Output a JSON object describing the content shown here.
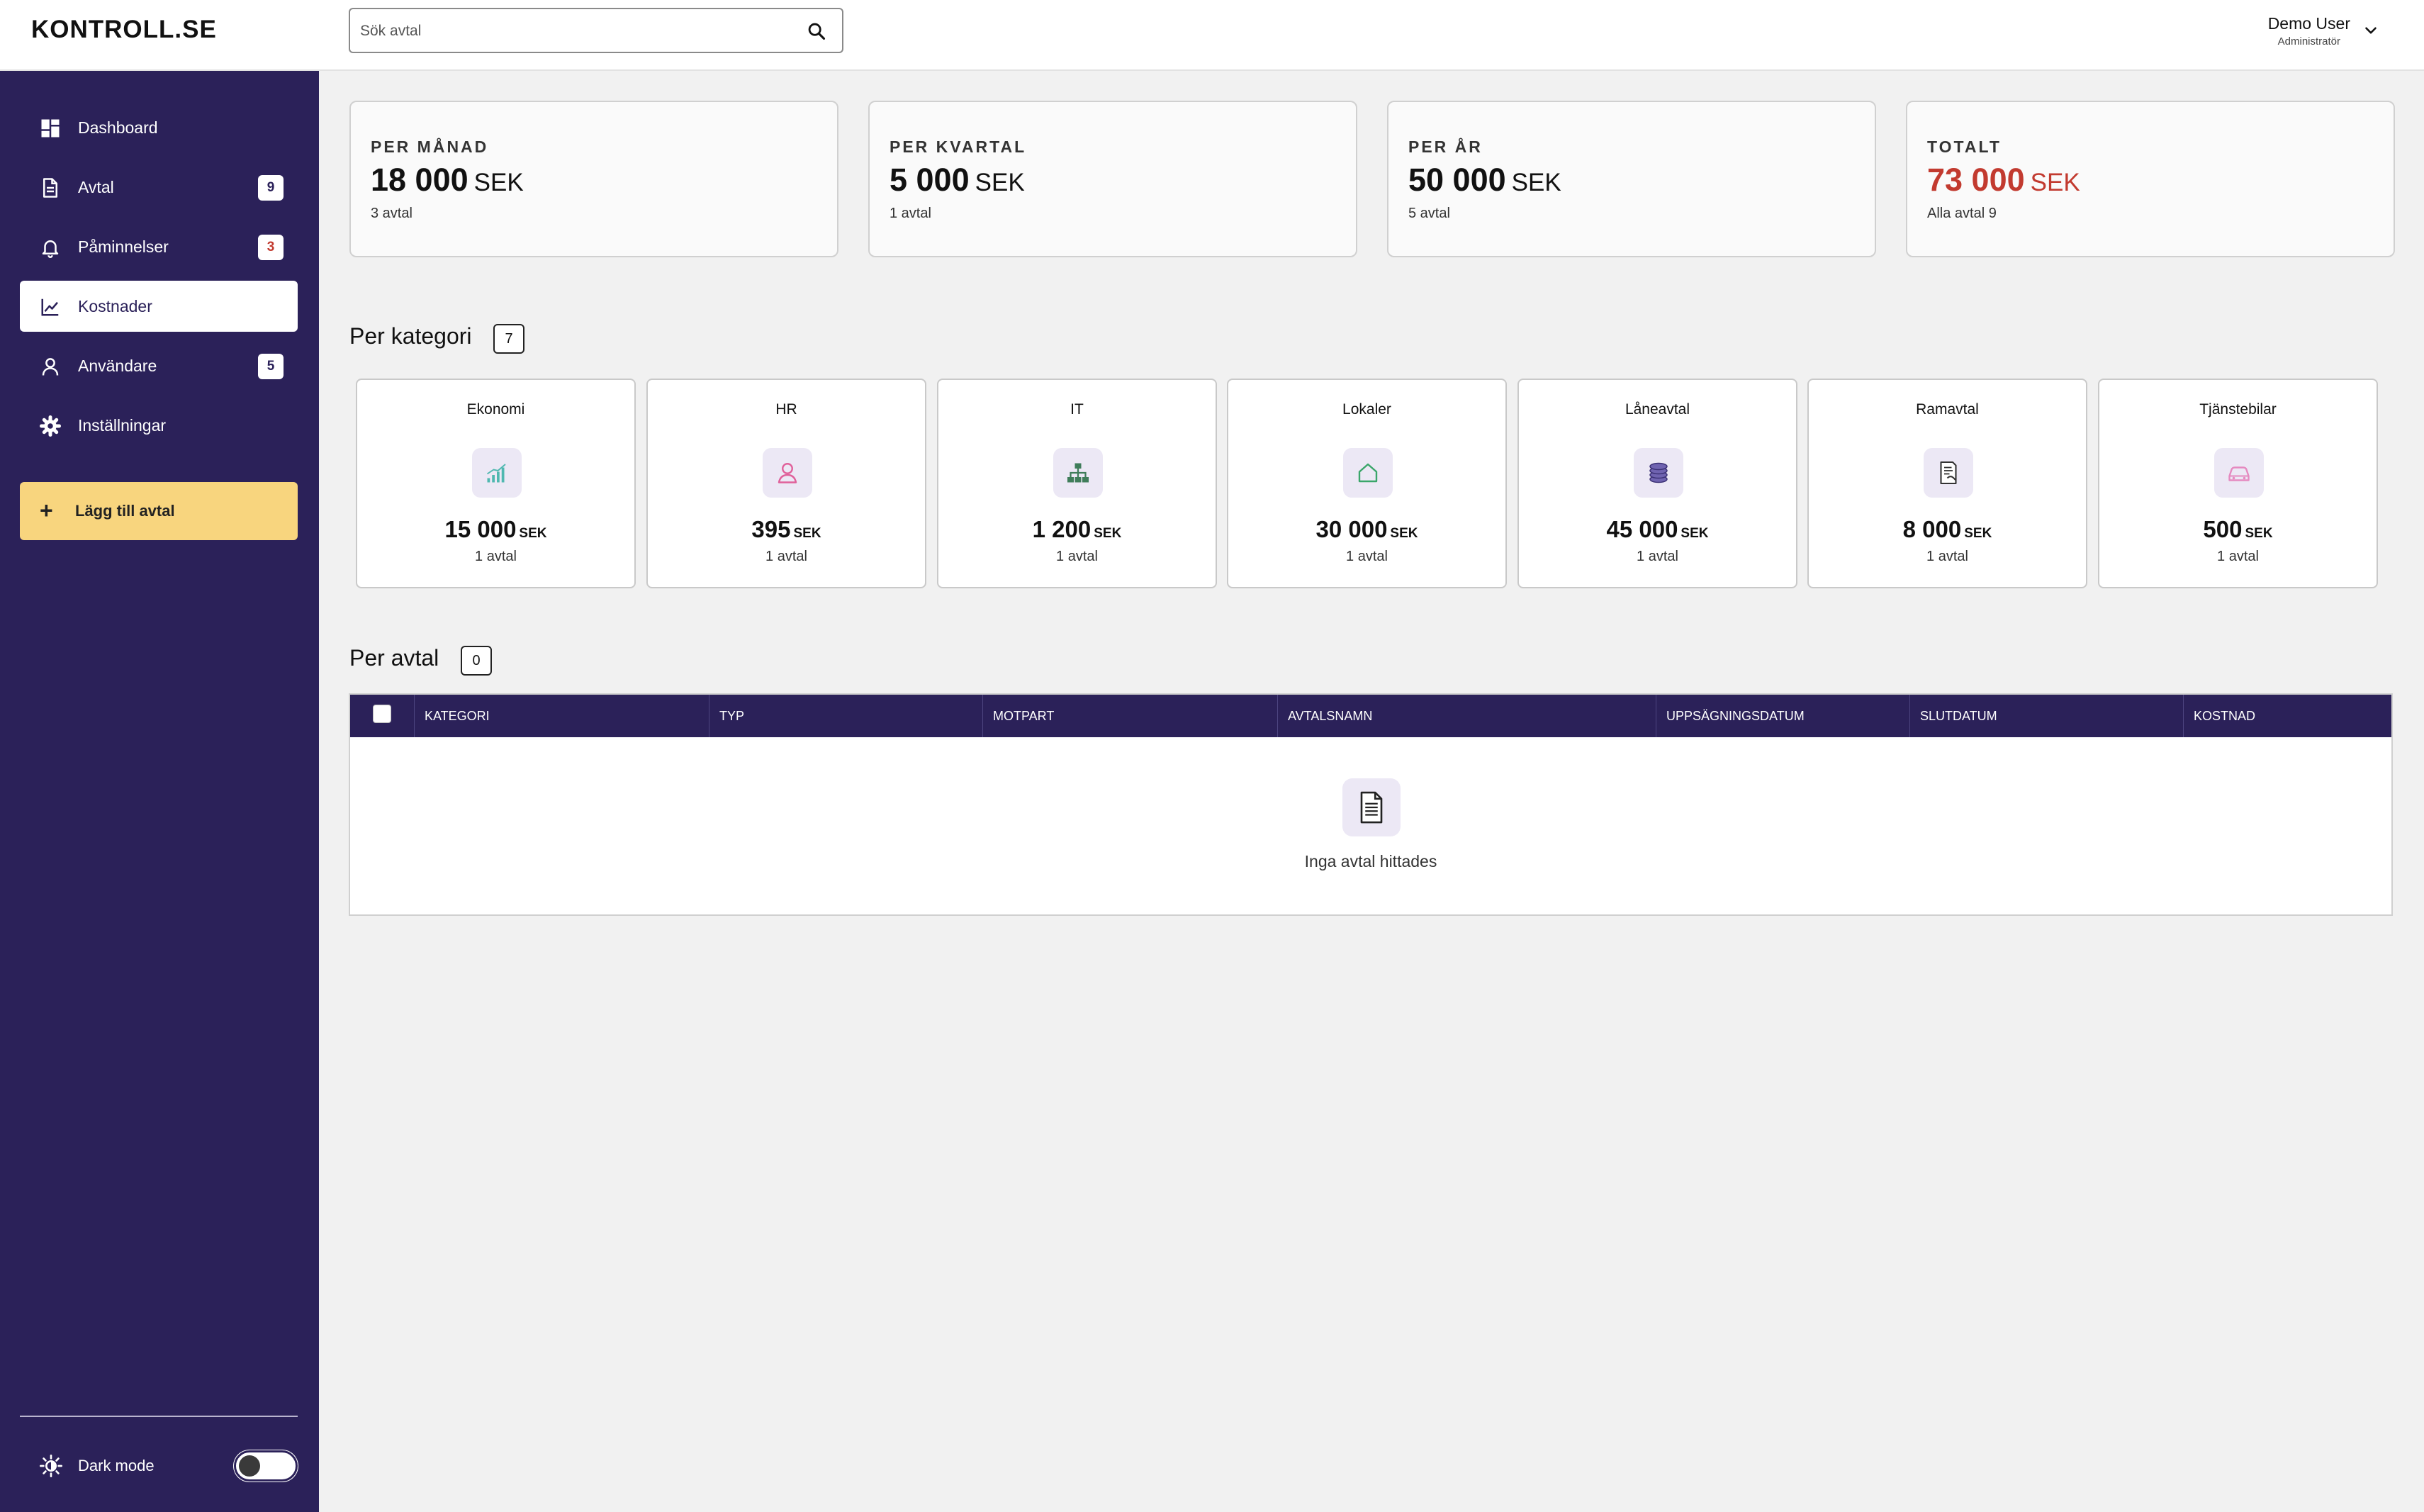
{
  "app": {
    "logo": "KONTROLL.SE"
  },
  "search": {
    "placeholder": "Sök avtal",
    "icon": "search-icon"
  },
  "user": {
    "name": "Demo User",
    "role": "Administratör"
  },
  "sidebar": {
    "items": [
      {
        "label": "Dashboard",
        "icon": "dashboard-icon",
        "badge": ""
      },
      {
        "label": "Avtal",
        "icon": "document-icon",
        "badge": "9"
      },
      {
        "label": "Påminnelser",
        "icon": "bell-icon",
        "badge": "3",
        "badge_color": "#c23a2f"
      },
      {
        "label": "Kostnader",
        "icon": "chart-icon",
        "badge": "",
        "active": true
      },
      {
        "label": "Användare",
        "icon": "user-icon",
        "badge": "5"
      },
      {
        "label": "Inställningar",
        "icon": "gear-icon",
        "badge": ""
      }
    ],
    "add_button": "Lägg till avtal",
    "dark_mode": {
      "label": "Dark mode",
      "enabled": false
    }
  },
  "summary": [
    {
      "label": "PER MÅNAD",
      "value": "18 000",
      "currency": "SEK",
      "sub": "3 avtal"
    },
    {
      "label": "PER KVARTAL",
      "value": "5 000",
      "currency": "SEK",
      "sub": "1 avtal"
    },
    {
      "label": "PER ÅR",
      "value": "50 000",
      "currency": "SEK",
      "sub": "5 avtal"
    },
    {
      "label": "TOTALT",
      "value": "73 000",
      "currency": "SEK",
      "sub": "Alla avtal 9",
      "color": "#c23a2f"
    }
  ],
  "per_kategori": {
    "title": "Per kategori",
    "count": "7",
    "categories": [
      {
        "name": "Ekonomi",
        "value": "15 000",
        "currency": "SEK",
        "sub": "1 avtal",
        "icon": "bar-chart-icon",
        "icon_color": "#4fb8b0"
      },
      {
        "name": "HR",
        "value": "395",
        "currency": "SEK",
        "sub": "1 avtal",
        "icon": "person-icon",
        "icon_color": "#e0609a"
      },
      {
        "name": "IT",
        "value": "1 200",
        "currency": "SEK",
        "sub": "1 avtal",
        "icon": "network-icon",
        "icon_color": "#3f7d5a"
      },
      {
        "name": "Lokaler",
        "value": "30 000",
        "currency": "SEK",
        "sub": "1 avtal",
        "icon": "house-icon",
        "icon_color": "#3aa66a"
      },
      {
        "name": "Låneavtal",
        "value": "45 000",
        "currency": "SEK",
        "sub": "1 avtal",
        "icon": "coins-icon",
        "icon_color": "#4a3f8a"
      },
      {
        "name": "Ramavtal",
        "value": "8 000",
        "currency": "SEK",
        "sub": "1 avtal",
        "icon": "contract-icon",
        "icon_color": "#333333"
      },
      {
        "name": "Tjänstebilar",
        "value": "500",
        "currency": "SEK",
        "sub": "1 avtal",
        "icon": "car-icon",
        "icon_color": "#e58ac0"
      }
    ]
  },
  "per_avtal": {
    "title": "Per avtal",
    "count": "0",
    "columns": [
      "KATEGORI",
      "TYP",
      "MOTPART",
      "AVTALSNAMN",
      "UPPSÄGNINGSDATUM",
      "SLUTDATUM",
      "KOSTNAD"
    ],
    "empty_text": "Inga avtal hittades",
    "empty_icon": "document-icon"
  }
}
